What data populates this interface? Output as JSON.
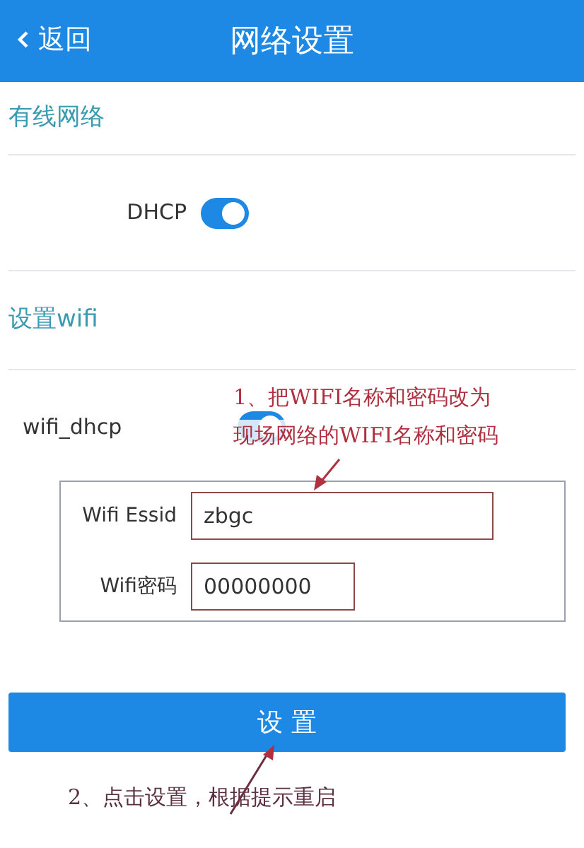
{
  "header": {
    "back": "返回",
    "title": "网络设置"
  },
  "sections": [
    {
      "title": "有线网络",
      "toggles": [
        {
          "label": "DHCP",
          "on": true
        }
      ]
    },
    {
      "title": "设置wifi",
      "toggles": [
        {
          "label": "wifi_dhcp",
          "on": true
        }
      ]
    }
  ],
  "fields": [
    {
      "label": "Wifi Essid",
      "value": "zbgc"
    },
    {
      "label": "Wifi密码",
      "value": "00000000"
    }
  ],
  "submit": "设 置",
  "annotations": [
    "1、把WIFI名称和密码改为",
    "现场网络的WIFI名称和密码",
    "2、点击设置，根据提示重启"
  ]
}
